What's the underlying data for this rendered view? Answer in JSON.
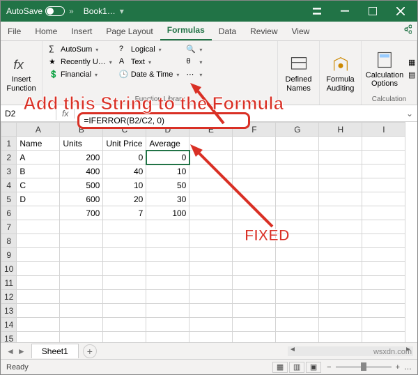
{
  "titlebar": {
    "autosave": "AutoSave",
    "autosave_state": "Off",
    "book": "Book1…"
  },
  "tabs": [
    "File",
    "Home",
    "Insert",
    "Page Layout",
    "Formulas",
    "Data",
    "Review",
    "View"
  ],
  "active_tab": "Formulas",
  "ribbon": {
    "insert_fn": "Insert\nFunction",
    "autosum": "AutoSum",
    "recent": "Recently U…",
    "financial": "Financial",
    "logical": "Logical",
    "text": "Text",
    "datetime": "Date & Time",
    "more": "",
    "lib_label": "Function Library",
    "defined": "Defined\nNames",
    "auditing": "Formula\nAuditing",
    "calc": "Calculation\nOptions",
    "calc_label": "Calculation"
  },
  "annotation1": "Add this String to the Formula",
  "annotation2": "FIXED",
  "namebox": "D2",
  "fx": "fx",
  "formula": "=IFERROR(B2/C2, 0)",
  "columns": [
    "A",
    "B",
    "C",
    "D",
    "E",
    "F",
    "G",
    "H",
    "I"
  ],
  "headers": {
    "A": "Name",
    "B": "Units",
    "C": "Unit Price",
    "D": "Average"
  },
  "rows": [
    {
      "n": "1"
    },
    {
      "n": "2",
      "A": "A",
      "B": "200",
      "C": "0",
      "D": "0"
    },
    {
      "n": "3",
      "A": "B",
      "B": "400",
      "C": "40",
      "D": "10"
    },
    {
      "n": "4",
      "A": "C",
      "B": "500",
      "C": "10",
      "D": "50"
    },
    {
      "n": "5",
      "A": "D",
      "B": "600",
      "C": "20",
      "D": "30"
    },
    {
      "n": "6",
      "A": "",
      "B": "700",
      "C": "7",
      "D": "100"
    },
    {
      "n": "7"
    },
    {
      "n": "8"
    },
    {
      "n": "9"
    },
    {
      "n": "10"
    },
    {
      "n": "11"
    },
    {
      "n": "12"
    },
    {
      "n": "13"
    },
    {
      "n": "14"
    },
    {
      "n": "15"
    }
  ],
  "sheet": "Sheet1",
  "status": "Ready",
  "zoom": "…",
  "watermark": "wsxdn.com"
}
